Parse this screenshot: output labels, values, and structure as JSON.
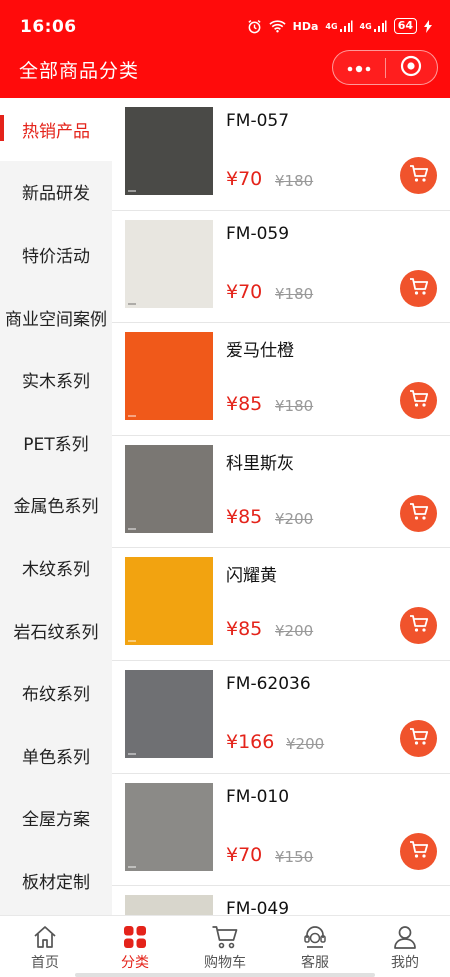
{
  "status_bar": {
    "time": "16:06",
    "network": "HDa",
    "signal1": "4G",
    "signal2": "4G",
    "battery": "64"
  },
  "header": {
    "title": "全部商品分类",
    "more_icon": "ellipsis-icon",
    "close_icon": "target-icon"
  },
  "sidebar": {
    "items": [
      {
        "label": "热销产品",
        "active": true
      },
      {
        "label": "新品研发"
      },
      {
        "label": "特价活动"
      },
      {
        "label": "商业空间案例"
      },
      {
        "label": "实木系列"
      },
      {
        "label": "PET系列"
      },
      {
        "label": "金属色系列"
      },
      {
        "label": "木纹系列"
      },
      {
        "label": "岩石纹系列"
      },
      {
        "label": "布纹系列"
      },
      {
        "label": "单色系列"
      },
      {
        "label": "全屋方案"
      },
      {
        "label": "板材定制"
      }
    ]
  },
  "products": [
    {
      "name": "FM-057",
      "price": "¥70",
      "original_price": "¥180",
      "swatch_color": "#4a4a47"
    },
    {
      "name": "FM-059",
      "price": "¥70",
      "original_price": "¥180",
      "swatch_color": "#e8e6e0"
    },
    {
      "name": "爱马仕橙",
      "price": "¥85",
      "original_price": "¥180",
      "swatch_color": "#f0591a"
    },
    {
      "name": "科里斯灰",
      "price": "¥85",
      "original_price": "¥200",
      "swatch_color": "#7a7773"
    },
    {
      "name": "闪耀黄",
      "price": "¥85",
      "original_price": "¥200",
      "swatch_color": "#f2a310"
    },
    {
      "name": "FM-62036",
      "price": "¥166",
      "original_price": "¥200",
      "swatch_color": "#6f7073"
    },
    {
      "name": "FM-010",
      "price": "¥70",
      "original_price": "¥150",
      "swatch_color": "#8b8a87"
    },
    {
      "name": "FM-049",
      "price": "",
      "original_price": "",
      "swatch_color": "#d8d6cc"
    }
  ],
  "tabbar": {
    "items": [
      {
        "label": "首页",
        "icon": "home-icon"
      },
      {
        "label": "分类",
        "icon": "category-icon",
        "active": true
      },
      {
        "label": "购物车",
        "icon": "cart-icon"
      },
      {
        "label": "客服",
        "icon": "customer-service-icon"
      },
      {
        "label": "我的",
        "icon": "profile-icon"
      }
    ]
  },
  "colors": {
    "brand_red": "#ff0b0b",
    "price_red": "#e4231a",
    "cart_button": "#f0532c"
  }
}
